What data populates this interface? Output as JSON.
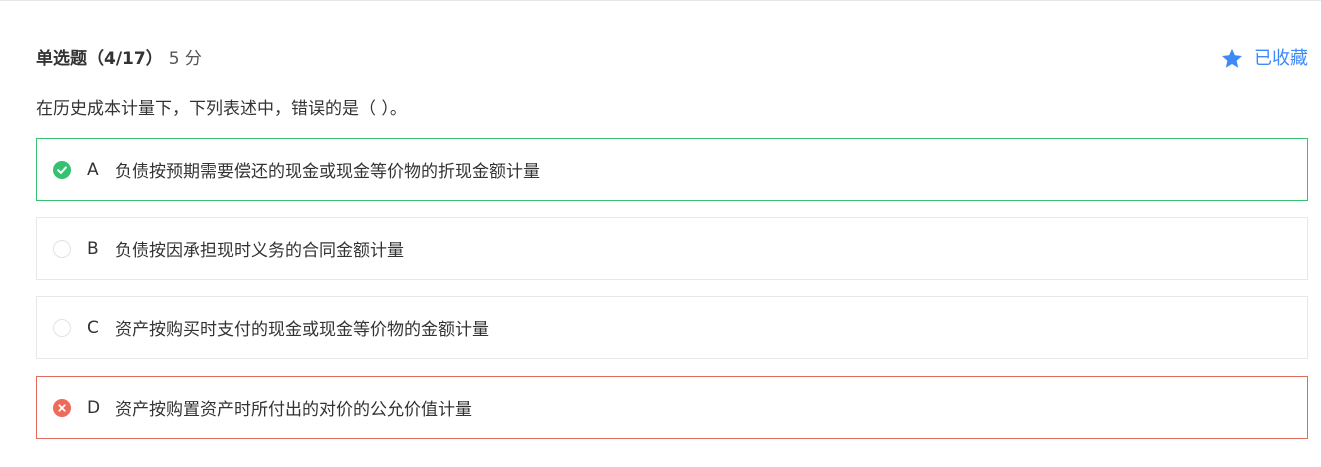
{
  "header": {
    "type_label": "单选题",
    "progress": "（4/17）",
    "score": "5 分",
    "favorite_label": "已收藏"
  },
  "question": {
    "text": "在历史成本计量下，下列表述中，错误的是（ ）。"
  },
  "options": [
    {
      "letter": "A",
      "text": "负债按预期需要偿还的现金或现金等价物的折现金额计量",
      "status": "correct"
    },
    {
      "letter": "B",
      "text": "负债按因承担现时义务的合同金额计量",
      "status": "none"
    },
    {
      "letter": "C",
      "text": "资产按购买时支付的现金或现金等价物的金额计量",
      "status": "none"
    },
    {
      "letter": "D",
      "text": "资产按购置资产时所付出的对价的公允价值计量",
      "status": "wrong"
    }
  ],
  "colors": {
    "accent_blue": "#3d8af7",
    "correct_green": "#35c16f",
    "wrong_red": "#e06a5f"
  },
  "icons": {
    "favorite": "star-icon",
    "correct": "check-circle-icon",
    "wrong": "x-circle-icon",
    "empty": "radio-empty-icon"
  }
}
